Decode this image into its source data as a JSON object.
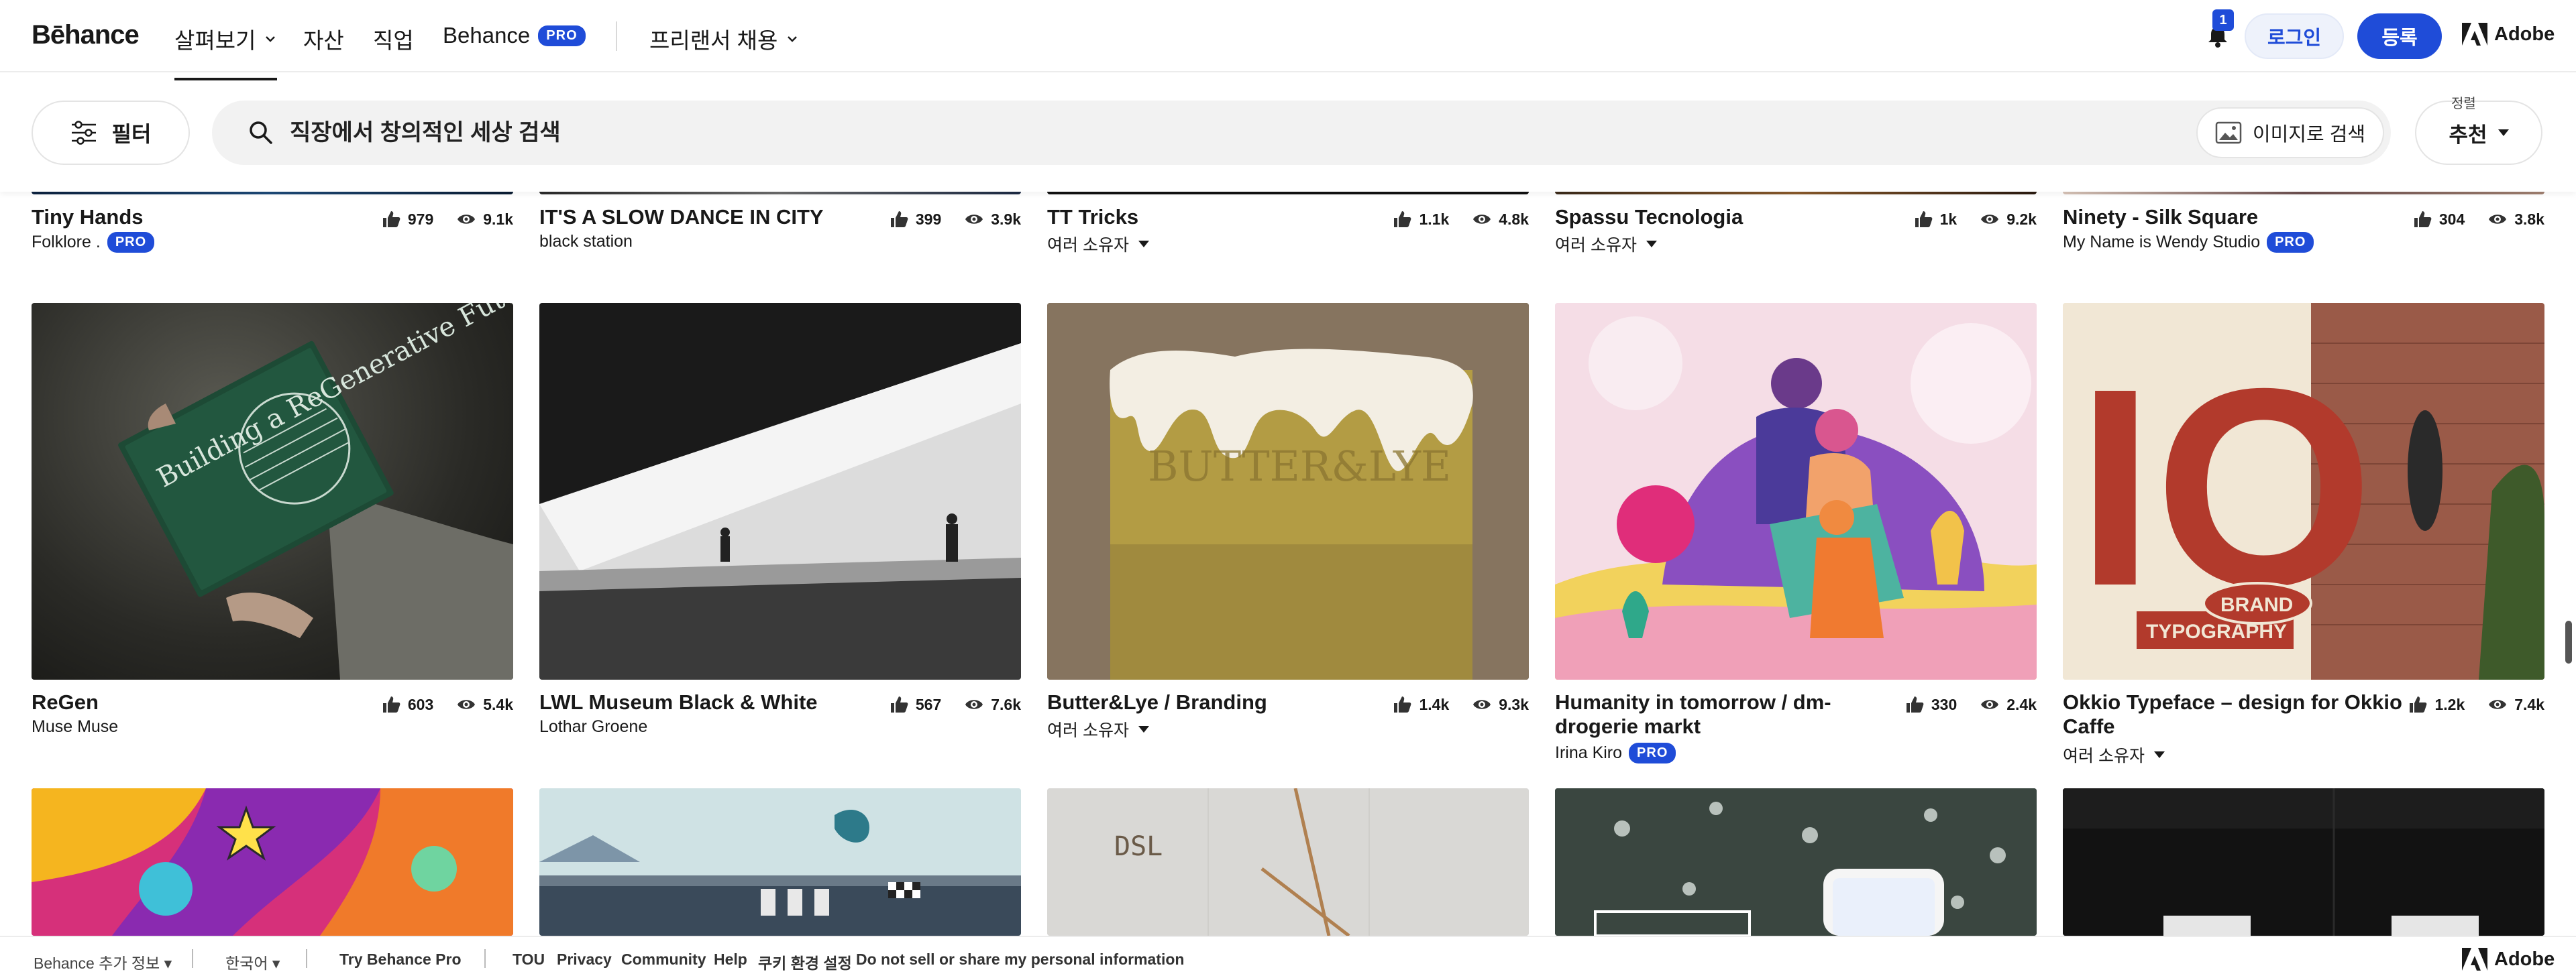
{
  "nav": {
    "logo": "Bēhance",
    "explore": "살펴보기",
    "assets": "자산",
    "jobs": "직업",
    "behance": "Behance",
    "pro": "PRO",
    "hire": "프리랜서 채용",
    "notif_count": "1",
    "login": "로그인",
    "signup": "등록",
    "adobe": "Adobe"
  },
  "search": {
    "filter_label": "필터",
    "placeholder": "직장에서 창의적인 세상 검색",
    "image_search": "이미지로 검색",
    "sort_label": "정렬",
    "sort_value": "추천"
  },
  "projects": [
    {
      "title": "Tiny Hands",
      "owner": "Folklore .",
      "pro": true,
      "likes": "979",
      "views": "9.1k",
      "multi": false
    },
    {
      "title": "IT'S A SLOW DANCE IN CITY",
      "owner": "black station",
      "pro": false,
      "likes": "399",
      "views": "3.9k",
      "multi": false
    },
    {
      "title": "TT Tricks",
      "owner": "여러 소유자",
      "pro": false,
      "likes": "1.1k",
      "views": "4.8k",
      "multi": true
    },
    {
      "title": "Spassu Tecnologia",
      "owner": "여러 소유자",
      "pro": false,
      "likes": "1k",
      "views": "9.2k",
      "multi": true
    },
    {
      "title": "Ninety - Silk Square",
      "owner": "My Name is Wendy Studio",
      "pro": true,
      "likes": "304",
      "views": "3.8k",
      "multi": false
    },
    {
      "title": "ReGen",
      "owner": "Muse Muse",
      "pro": false,
      "likes": "603",
      "views": "5.4k",
      "multi": false,
      "art": "Building a ReGenerative Future"
    },
    {
      "title": "LWL Museum Black & White",
      "owner": "Lothar Groene",
      "pro": false,
      "likes": "567",
      "views": "7.6k",
      "multi": false
    },
    {
      "title": "Butter&Lye / Branding",
      "owner": "여러 소유자",
      "pro": false,
      "likes": "1.4k",
      "views": "9.3k",
      "multi": true,
      "art": "BUTTER&LYE"
    },
    {
      "title": "Humanity in tomorrow / dm-drogerie markt",
      "owner": "Irina Kiro",
      "pro": true,
      "likes": "330",
      "views": "2.4k",
      "multi": false
    },
    {
      "title": "Okkio Typeface – design for Okkio Caffe",
      "owner": "여러 소유자",
      "pro": false,
      "likes": "1.2k",
      "views": "7.4k",
      "multi": true,
      "art_big": "IO",
      "art_brand": "BRAND",
      "art_typo": "TYPOGRAPHY"
    },
    {
      "art": "DSL"
    }
  ],
  "footer": {
    "more": "Behance 추가 정보",
    "lang": "한국어",
    "try_pro": "Try Behance Pro",
    "tou": "TOU",
    "privacy": "Privacy",
    "community": "Community",
    "help": "Help",
    "cookies": "쿠키 환경 설정",
    "dnsmpi": "Do not sell or share my personal information",
    "adobe": "Adobe"
  },
  "colors": {
    "accent": "#1f4cd8",
    "text": "#191919"
  }
}
